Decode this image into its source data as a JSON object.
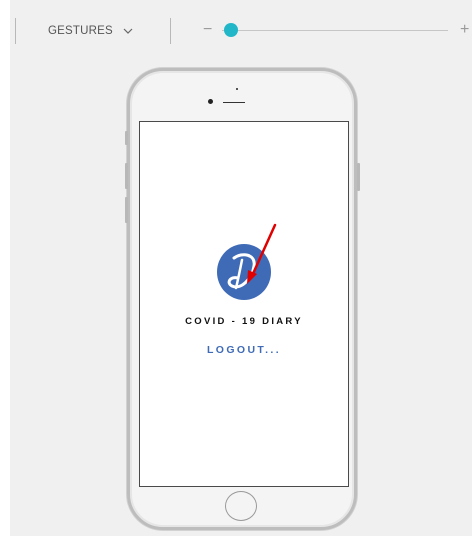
{
  "toolbar": {
    "gestures_label": "GESTURES",
    "zoom_minus": "−",
    "zoom_plus": "+",
    "zoom_level": 0.05
  },
  "app": {
    "title": "COVID - 19 DIARY",
    "status": "LOGOUT...",
    "logo_letter": "D",
    "colors": {
      "logo_blue": "#3f6bb6",
      "slider_accent": "#21b7c8",
      "annotation_red": "#e00000"
    }
  },
  "icons": [
    "chevron-down-icon",
    "app-logo-icon",
    "annotation-arrow-icon"
  ]
}
